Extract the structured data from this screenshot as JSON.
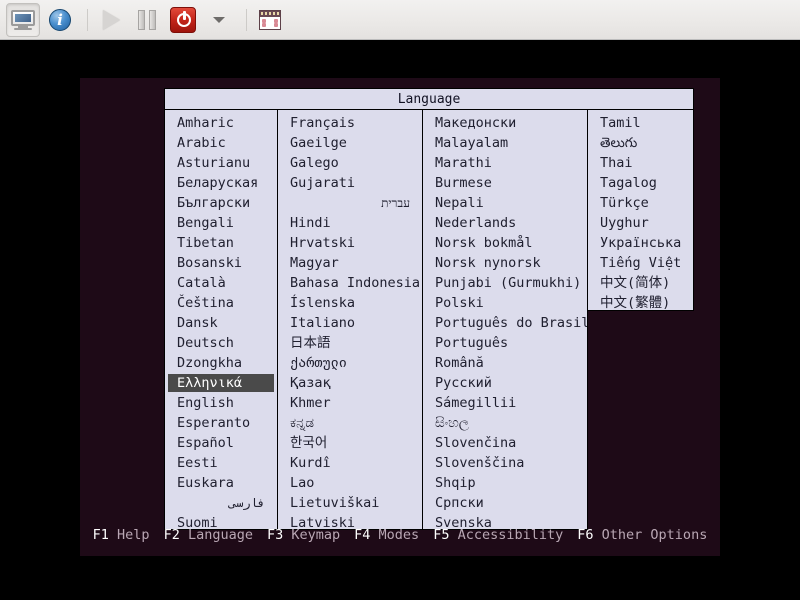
{
  "toolbar": {
    "buttons": [
      {
        "name": "display-toggle",
        "icon": "monitor-icon",
        "state": "pressed"
      },
      {
        "name": "guest-details",
        "icon": "info-icon",
        "state": "normal"
      },
      {
        "name": "run",
        "icon": "play-icon",
        "state": "disabled"
      },
      {
        "name": "pause",
        "icon": "pause-icon",
        "state": "normal"
      },
      {
        "name": "shutdown",
        "icon": "power-icon",
        "state": "normal"
      },
      {
        "name": "shutdown-menu",
        "icon": "chevron-down-icon",
        "state": "normal"
      },
      {
        "name": "screenshot",
        "icon": "screenshot-icon",
        "state": "normal"
      }
    ]
  },
  "dialog": {
    "title": "Language",
    "selected": "Ελληνικά",
    "columns": [
      {
        "id": "column-1",
        "items": [
          "Amharic",
          "Arabic",
          "Asturianu",
          "Беларуская",
          "Български",
          "Bengali",
          "Tibetan",
          "Bosanski",
          "Català",
          "Čeština",
          "Dansk",
          "Deutsch",
          "Dzongkha",
          "Ελληνικά",
          "English",
          "Esperanto",
          "Español",
          "Eesti",
          "Euskara",
          "فارسی",
          "Suomi"
        ]
      },
      {
        "id": "column-2",
        "items": [
          "Français",
          "Gaeilge",
          "Galego",
          "Gujarati",
          "עברית",
          "Hindi",
          "Hrvatski",
          "Magyar",
          "Bahasa Indonesia",
          "Íslenska",
          "Italiano",
          "日本語",
          "ქართული",
          "Қазақ",
          "Khmer",
          "ಕನ್ನಡ",
          "한국어",
          "Kurdî",
          "Lao",
          "Lietuviškai",
          "Latviski"
        ]
      },
      {
        "id": "column-3",
        "items": [
          "Македонски",
          "Malayalam",
          "Marathi",
          "Burmese",
          "Nepali",
          "Nederlands",
          "Norsk bokmål",
          "Norsk nynorsk",
          "Punjabi (Gurmukhi)",
          "Polski",
          "Português do Brasil",
          "Português",
          "Română",
          "Русский",
          "Sámegillii",
          "සිංහල",
          "Slovenčina",
          "Slovenščina",
          "Shqip",
          "Српски",
          "Svenska"
        ]
      },
      {
        "id": "column-4",
        "items": [
          "Tamil",
          "తెలుగు",
          "Thai",
          "Tagalog",
          "Türkçe",
          "Uyghur",
          "Українська",
          "Tiếng Việt",
          "中文(简体)",
          "中文(繁體)"
        ]
      }
    ]
  },
  "function_bar": {
    "entries": [
      {
        "key": "F1",
        "label": "Help"
      },
      {
        "key": "F2",
        "label": "Language"
      },
      {
        "key": "F3",
        "label": "Keymap"
      },
      {
        "key": "F4",
        "label": "Modes"
      },
      {
        "key": "F5",
        "label": "Accessibility"
      },
      {
        "key": "F6",
        "label": "Other Options"
      }
    ]
  },
  "colors": {
    "screen_background": "#1e0a17",
    "dialog_background": "#dcdcec",
    "selection": "#4a4a4a",
    "fn_key": "#ffffff",
    "fn_label": "#b9a7b4",
    "power_button": "#c3251a"
  }
}
